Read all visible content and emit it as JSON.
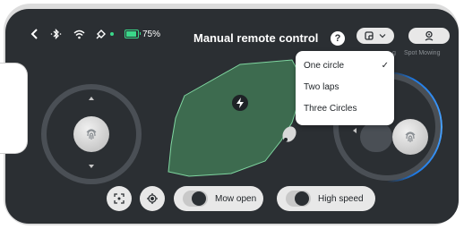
{
  "status_bar": {
    "battery_text": "75%",
    "battery_level": 0.75,
    "icons": [
      "back-icon",
      "bluetooth-icon",
      "wifi-icon",
      "satellite-icon"
    ]
  },
  "header": {
    "title": "Manual remote control",
    "help_label": "?"
  },
  "top_right": {
    "spot_mowing_label": "Spot Mowing",
    "partial_label": "g"
  },
  "mode_menu": {
    "items": [
      {
        "label": "One circle",
        "selected": true
      },
      {
        "label": "Two laps",
        "selected": false
      },
      {
        "label": "Three Circles",
        "selected": false
      }
    ],
    "check_glyph": "✓"
  },
  "controls": {
    "mow_label": "Mow open",
    "speed_label": "High speed"
  },
  "colors": {
    "background": "#2b2f33",
    "map_fill": "#3d6b4f",
    "map_outline": "#7fd6a0",
    "accent_blue": "#1e7ae6",
    "battery_green": "#3ad88a"
  }
}
